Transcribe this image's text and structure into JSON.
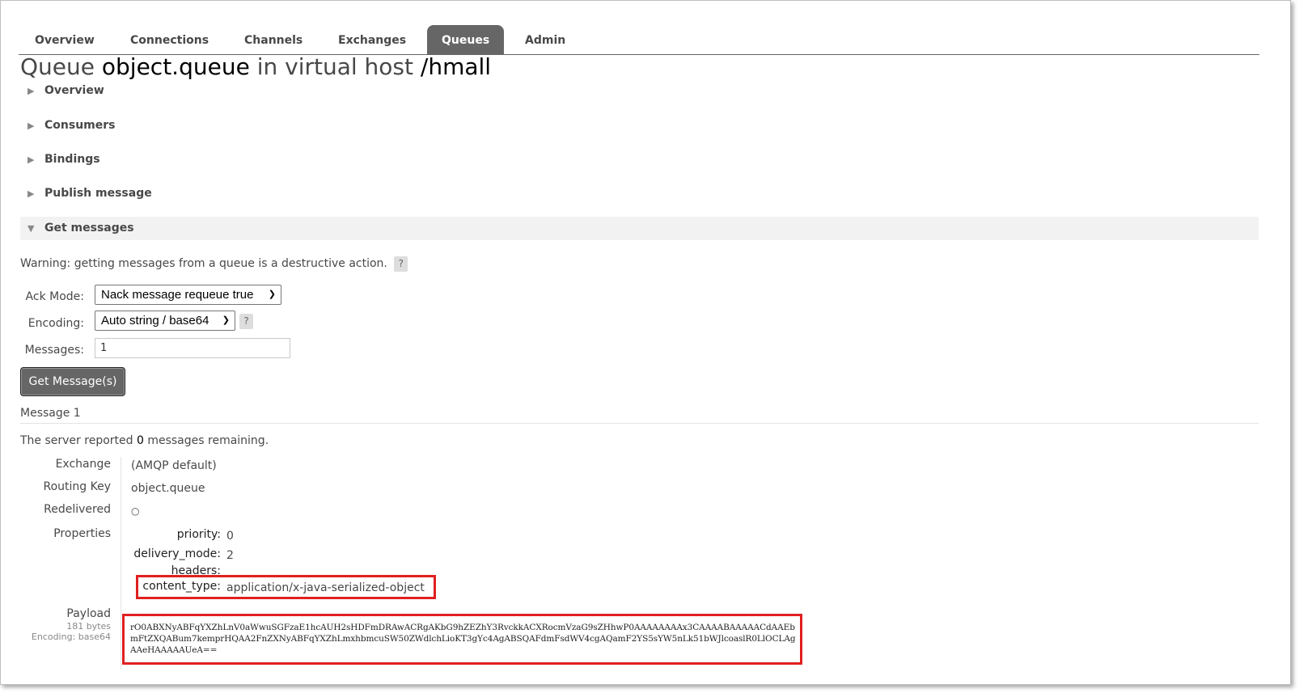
{
  "nav": {
    "tabs": [
      {
        "label": "Overview"
      },
      {
        "label": "Connections"
      },
      {
        "label": "Channels"
      },
      {
        "label": "Exchanges"
      },
      {
        "label": "Queues"
      },
      {
        "label": "Admin"
      }
    ],
    "active_tab": "Queues"
  },
  "title": {
    "prefix": "Queue",
    "queue_name": "object.queue",
    "middle": "in virtual host",
    "vhost": "/hmall"
  },
  "sections": {
    "overview": "Overview",
    "consumers": "Consumers",
    "bindings": "Bindings",
    "publish": "Publish message",
    "get": "Get messages"
  },
  "get_messages": {
    "warning": "Warning: getting messages from a queue is a destructive action.",
    "help_glyph": "?",
    "ack_mode_label": "Ack Mode:",
    "ack_mode_value": "Nack message requeue true",
    "encoding_label": "Encoding:",
    "encoding_value": "Auto string / base64",
    "messages_label": "Messages:",
    "messages_value": "1",
    "button": "Get Message(s)"
  },
  "message": {
    "heading": "Message 1",
    "remaining_prefix": "The server reported",
    "remaining_count": "0",
    "remaining_suffix": "messages remaining.",
    "exchange_label": "Exchange",
    "exchange_value": "(AMQP default)",
    "routing_key_label": "Routing Key",
    "routing_key_value": "object.queue",
    "redelivered_label": "Redelivered",
    "redelivered_value": "○",
    "properties_label": "Properties",
    "properties": {
      "priority_label": "priority:",
      "priority_value": "0",
      "delivery_mode_label": "delivery_mode:",
      "delivery_mode_value": "2",
      "headers_label": "headers:",
      "content_type_label": "content_type:",
      "content_type_value": "application/x-java-serialized-object"
    },
    "payload_label": "Payload",
    "payload_size": "181 bytes",
    "payload_encoding": "Encoding: base64",
    "payload_value": "rO0ABXNyABFqYXZhLnV0aWwuSGFzaE1hcAUH2sHDFmDRAwACRgAKbG9hZEZhY3RvckkACXRocmVzaG9sZHhwP0AAAAAAAAx3CAAAABAAAAACdAAEbmFtZXQABum7kemprHQAA2FnZXNyABFqYXZhLmxhbmcuSW50ZWdlchLioKT3gYc4AgABSQAFdmFsdWV4cgAQamF2YS5sYW5nLk51bWJlcoaslR0LlOCLAgAAeHAAAAAUeA=="
  }
}
